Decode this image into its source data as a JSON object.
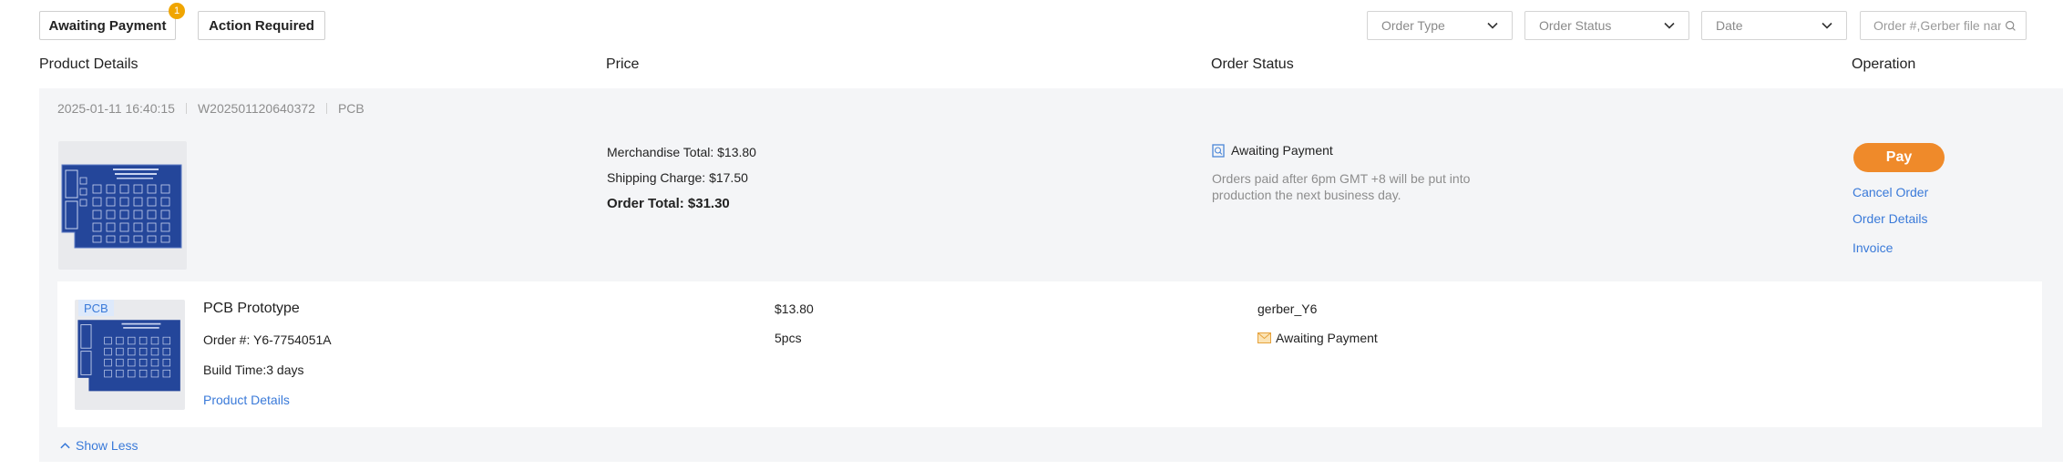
{
  "tabs": [
    {
      "label": "Awaiting Payment",
      "badge": "1"
    },
    {
      "label": "Action Required"
    }
  ],
  "filters": {
    "order_type": "Order Type",
    "order_status": "Order Status",
    "date": "Date",
    "search_placeholder": "Order #,Gerber file name"
  },
  "columns": {
    "product": "Product Details",
    "price": "Price",
    "status": "Order Status",
    "operation": "Operation"
  },
  "order": {
    "date": "2025-01-11 16:40:15",
    "number": "W202501120640372",
    "category": "PCB",
    "merchandise_total": "Merchandise Total: $13.80",
    "shipping_charge": "Shipping Charge: $17.50",
    "order_total": "Order Total:  $31.30",
    "status": "Awaiting Payment",
    "status_note": "Orders paid after 6pm GMT +8 will be put into production the next business day.",
    "actions": {
      "pay": "Pay",
      "cancel": "Cancel Order",
      "details": "Order Details",
      "invoice": "Invoice"
    },
    "item": {
      "tag": "PCB",
      "title": "PCB Prototype",
      "order_no": "Order #: Y6-7754051A",
      "build_time": "Build Time:3 days",
      "details_link": "Product Details",
      "price": "$13.80",
      "qty": "5pcs",
      "file": "gerber_Y6",
      "status": "Awaiting Payment"
    },
    "show_less": "Show Less"
  },
  "colors": {
    "accent": "#ef8a2a",
    "link": "#3a7ad9",
    "badge": "#f0a500",
    "pcb_board": "#24469a"
  }
}
